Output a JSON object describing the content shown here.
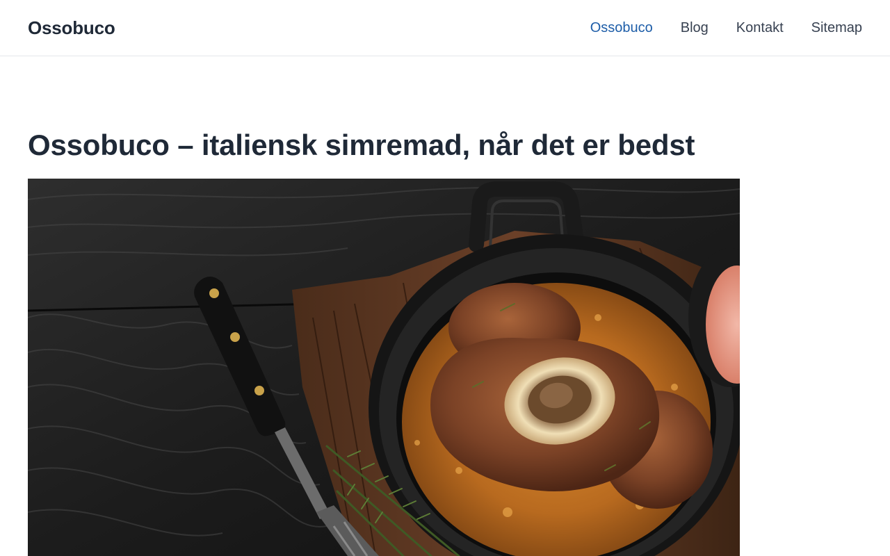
{
  "site": {
    "title": "Ossobuco"
  },
  "nav": {
    "items": [
      {
        "label": "Ossobuco",
        "active": true
      },
      {
        "label": "Blog",
        "active": false
      },
      {
        "label": "Kontakt",
        "active": false
      },
      {
        "label": "Sitemap",
        "active": false
      }
    ]
  },
  "article": {
    "title": "Ossobuco – italiensk simremad, når det er bedst"
  },
  "colors": {
    "text": "#1f2937",
    "link_active": "#1d5da8",
    "border": "#e5e7eb"
  }
}
